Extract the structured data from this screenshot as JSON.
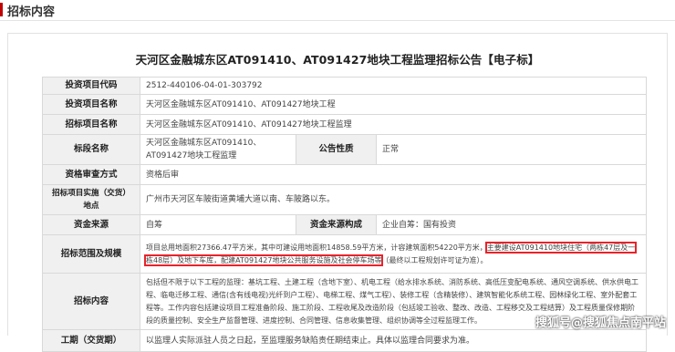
{
  "section_title": "招标内容",
  "doc_title": "天河区金融城东区AT091410、AT091427地块工程监理招标公告【电子标】",
  "rows": {
    "code": {
      "label": "投资项目代码",
      "value": "2512-440106-04-01-303792"
    },
    "invest_name": {
      "label": "投资项目名称",
      "value": "天河区金融城东区AT091410、AT091427地块工程"
    },
    "tender_name": {
      "label": "招标项目名称",
      "value": "天河区金融城东区AT091410、AT091427地块工程监理"
    },
    "section": {
      "label": "标段名称",
      "value": "天河区金融城东区AT091410、AT091427地块工程监理",
      "label2": "公告性质",
      "value2": "正常"
    },
    "qual": {
      "label": "资格审查方式",
      "value": "资格后审"
    },
    "location": {
      "label": "招标项目实施（交货）地点",
      "value": "广州市天河区车陂街道黄埔大道以南、车陂路以东。"
    },
    "funds": {
      "label": "资金来源",
      "value": "自筹",
      "label2": "资金来源构成",
      "value2": "企业自筹：国有投资"
    },
    "scope": {
      "label": "招标范围及规模",
      "part1": "项目总用地面积27366.47平方米，其中可建设用地面积14858.59平方米，计容建筑面积54220平方米，",
      "hl1": "主要建设AT091410地块住宅（两栋47层及一栋48层）及地下车库，配建AT091427地块公共服务设施及社会停车场等",
      "part2": "（最终以工程规划许可证为准）。"
    },
    "content": {
      "label": "招标内容",
      "value": "包括但不限于以下工程的监理：基坑工程、土建工程（含地下室）、机电工程（给水排水系统、消防系统、高低压变配电系统、通风空调系统、供水供电工程、临电迁移工程、通信(含有线电视)光纤到户工程）、电梯工程、煤气工程）、装修工程（含精装修）、建筑智能化系统工程、园林绿化工程、室外配套工程等。工作内容包括建设项目工程准备阶段、施工阶段、工程收尾及改造阶段（包括竣工验收、整改、改造、工程移交及工程结算）及工程质量保修期阶段的质量控制、安全生产监督管理、进度控制、合同管理、信息收集管理、组织协调等全过程监理工作。"
    },
    "period": {
      "label": "工期（交货期）",
      "value": "以监理人实际派驻人员之日起，至监理服务缺陷责任期结束止。具体以监理合同要求为准。"
    }
  },
  "watermark": "搜狐号@搜狐焦点南平站",
  "colors": {
    "highlight": "#e8232b",
    "accent": "#c00000",
    "label_bg": "#f0f0f0"
  }
}
